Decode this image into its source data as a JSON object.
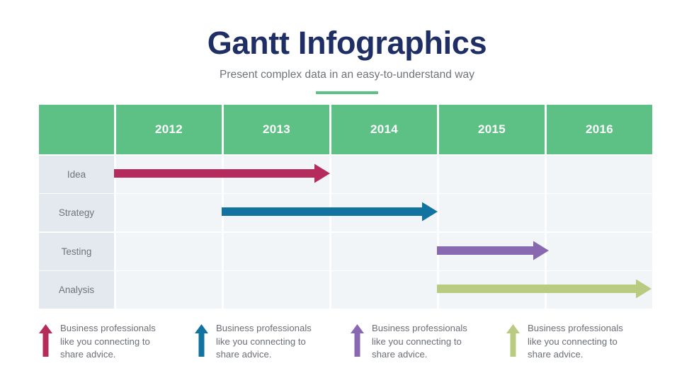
{
  "header": {
    "title": "Gantt Infographics",
    "subtitle": "Present complex data in an easy-to-understand way",
    "accent_color": "#5DC185",
    "title_color": "#1F2F66"
  },
  "chart_data": {
    "type": "bar",
    "title": "Gantt Infographics",
    "subtitle": "Present complex data in an easy-to-understand way",
    "xlabel": "",
    "ylabel": "",
    "orientation": "horizontal",
    "categories": [
      "Idea",
      "Strategy",
      "Testing",
      "Analysis"
    ],
    "x_ticks": [
      "2012",
      "2013",
      "2014",
      "2015",
      "2016"
    ],
    "xlim": [
      2012,
      2017
    ],
    "grid": true,
    "legend_position": "bottom",
    "header_fill": "#5DC185",
    "label_cell_fill": "#E3E9EF",
    "track_cell_fill": "#F1F5F8",
    "tasks": [
      {
        "name": "Idea",
        "start": 2012,
        "end": 2014.0,
        "color": "#B42B5C",
        "start_col": 0,
        "span_cols": 2.0
      },
      {
        "name": "Strategy",
        "start": 2013,
        "end": 2015.0,
        "color": "#1272A0",
        "start_col": 1,
        "span_cols": 2.0
      },
      {
        "name": "Testing",
        "start": 2015,
        "end": 2016.0,
        "color": "#8868B0",
        "start_col": 3,
        "span_cols": 1.0
      },
      {
        "name": "Analysis",
        "start": 2015,
        "end": 2017.0,
        "color": "#B9CB81",
        "start_col": 3,
        "span_cols": 2.0
      }
    ]
  },
  "table": {
    "corner_label": "",
    "years": [
      "2012",
      "2013",
      "2014",
      "2015",
      "2016"
    ],
    "rows": [
      {
        "label": "Idea"
      },
      {
        "label": "Strategy"
      },
      {
        "label": "Testing"
      },
      {
        "label": "Analysis"
      }
    ]
  },
  "legend": {
    "items": [
      {
        "color": "#B42B5C",
        "text": "Business professionals\nlike you connecting to\nshare advice."
      },
      {
        "color": "#1272A0",
        "text": "Business professionals\nlike you connecting to\nshare advice."
      },
      {
        "color": "#8868B0",
        "text": "Business professionals\nlike you connecting to\nshare advice."
      },
      {
        "color": "#B9CB81",
        "text": "Business professionals\nlike you connecting to\nshare advice."
      }
    ]
  }
}
